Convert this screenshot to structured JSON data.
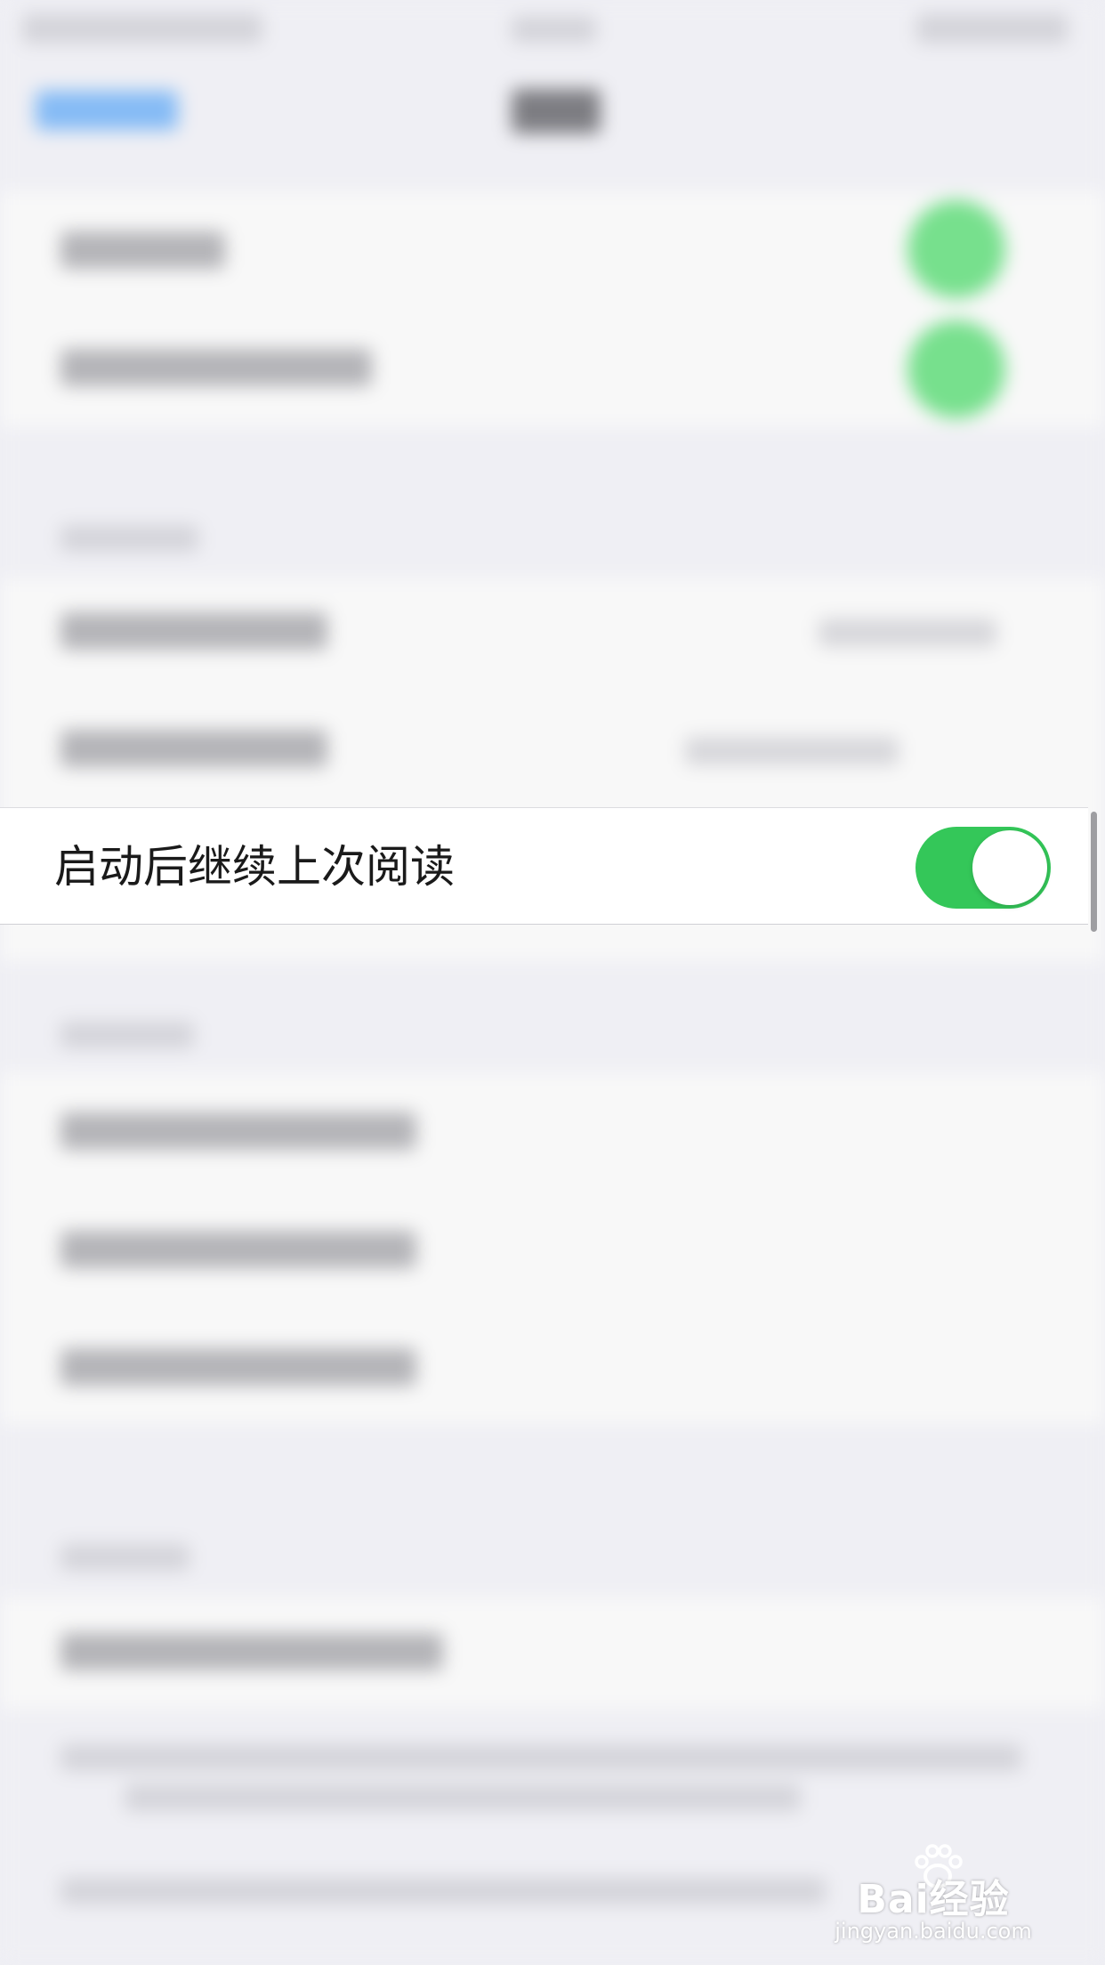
{
  "settings_row": {
    "label": "启动后继续上次阅读",
    "toggle_on": true
  },
  "colors": {
    "toggle_on": "#34c759",
    "background": "#efeff4",
    "row_background": "#ffffff"
  },
  "watermark": {
    "main": "Bai经验",
    "sub": "jingyan.baidu.com"
  }
}
